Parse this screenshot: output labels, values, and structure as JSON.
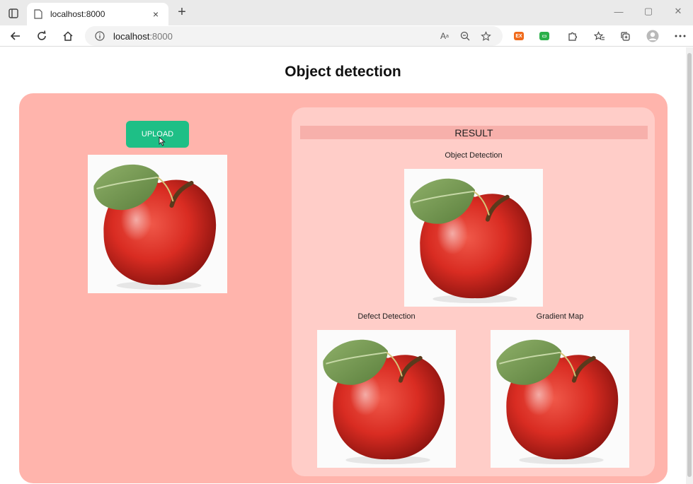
{
  "browser": {
    "tab_title": "localhost:8000",
    "tab_close": "×",
    "new_tab": "+",
    "url_host": "localhost",
    "url_port": ":8000",
    "window_controls": [
      "—",
      "▢",
      "✕"
    ],
    "toolbar_icons": [
      "read-aloud-icon",
      "zoom-icon",
      "favorite-add-icon",
      "extension-orange-icon",
      "extension-green-icon",
      "extensions-icon",
      "favorites-icon",
      "collections-icon",
      "profile-icon",
      "more-icon"
    ]
  },
  "page": {
    "title": "Object detection",
    "upload_label": "UPLOAD",
    "result_header": "RESULT",
    "captions": {
      "object_detection": "Object Detection",
      "defect_detection": "Defect Detection",
      "gradient_map": "Gradient Map"
    },
    "colors": {
      "main_panel": "#ffb4ac",
      "result_panel": "#ffcdc8",
      "upload_button": "#1ebf86"
    }
  }
}
